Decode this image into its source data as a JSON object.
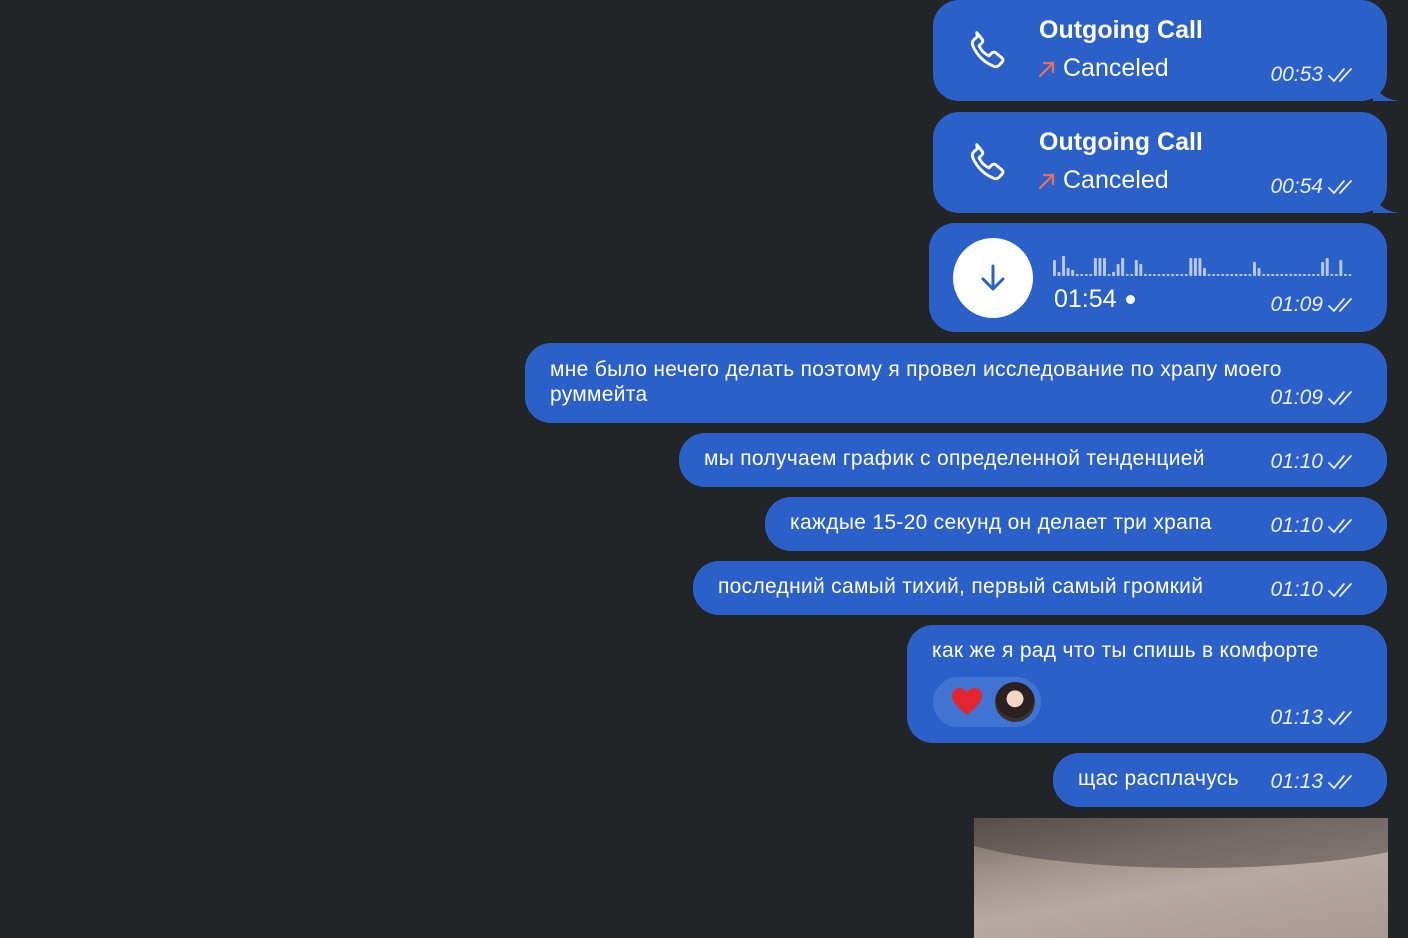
{
  "messages": [
    {
      "type": "call",
      "title": "Outgoing Call",
      "status": "Canceled",
      "time": "00:53"
    },
    {
      "type": "call",
      "title": "Outgoing Call",
      "status": "Canceled",
      "time": "00:54"
    },
    {
      "type": "voice",
      "duration": "01:54",
      "time": "01:09"
    },
    {
      "type": "text",
      "text": "мне было нечего делать поэтому я провел исследование по храпу моего руммейта",
      "time": "01:09"
    },
    {
      "type": "text",
      "text": "мы получаем график с определенной тенденцией",
      "time": "01:10"
    },
    {
      "type": "text",
      "text": "каждые 15-20 секунд он делает три храпа",
      "time": "01:10"
    },
    {
      "type": "text",
      "text": "последний самый тихий, первый самый громкий",
      "time": "01:10"
    },
    {
      "type": "text",
      "text": "как же я рад что ты спишь в комфорте",
      "time": "01:13",
      "reaction": "heart-icon"
    },
    {
      "type": "text",
      "text": "щас расплачусь",
      "time": "01:13"
    },
    {
      "type": "photo"
    }
  ],
  "colors": {
    "background": "#212528",
    "bubble": "#2b60c9",
    "reaction_pill": "#3f74d3",
    "canceled_arrow": "#e8705f",
    "heart": "#e3252f"
  },
  "icons": [
    "phone-icon",
    "arrow-up-right-icon",
    "double-check-icon",
    "download-icon",
    "heart-icon"
  ]
}
